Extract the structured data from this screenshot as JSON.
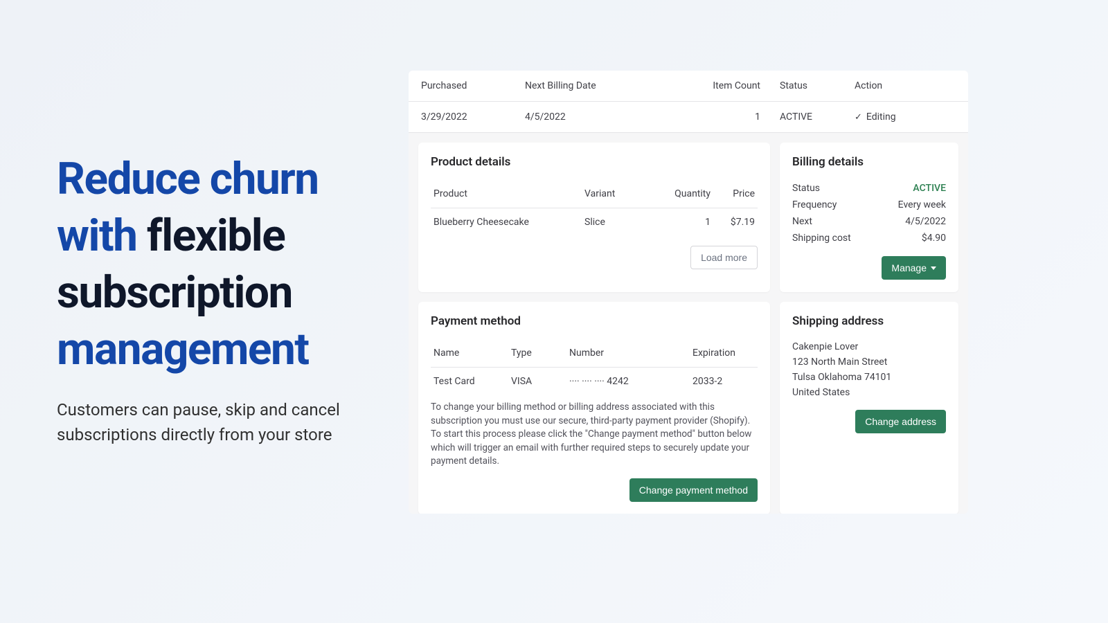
{
  "hero": {
    "line1": "Reduce churn with",
    "line2a": "flexible subscription",
    "line2b": "management",
    "sub": "Customers can pause, skip and cancel subscriptions directly from your store"
  },
  "top": {
    "headers": {
      "purchased": "Purchased",
      "next": "Next Billing Date",
      "count": "Item Count",
      "status": "Status",
      "action": "Action"
    },
    "row": {
      "purchased": "3/29/2022",
      "next": "4/5/2022",
      "count": "1",
      "status": "ACTIVE",
      "action": "Editing"
    }
  },
  "product": {
    "title": "Product details",
    "headers": {
      "product": "Product",
      "variant": "Variant",
      "qty": "Quantity",
      "price": "Price"
    },
    "row": {
      "product": "Blueberry Cheesecake",
      "variant": "Slice",
      "qty": "1",
      "price": "$7.19"
    },
    "load_more": "Load more"
  },
  "billing": {
    "title": "Billing details",
    "rows": [
      {
        "label": "Status",
        "value": "ACTIVE",
        "active": true
      },
      {
        "label": "Frequency",
        "value": "Every week"
      },
      {
        "label": "Next",
        "value": "4/5/2022"
      },
      {
        "label": "Shipping cost",
        "value": "$4.90"
      }
    ],
    "manage": "Manage"
  },
  "payment": {
    "title": "Payment method",
    "headers": {
      "name": "Name",
      "type": "Type",
      "number": "Number",
      "exp": "Expiration"
    },
    "row": {
      "name": "Test Card",
      "type": "VISA",
      "number": "···· ···· ···· 4242",
      "exp": "2033-2"
    },
    "note": "To change your billing method or billing address associated with this subscription you must use our secure, third-party payment provider (Shopify). To start this process please click the \"Change payment method\" button below which will trigger an email with further required steps to securely update your payment details.",
    "button": "Change payment method"
  },
  "shipping": {
    "title": "Shipping address",
    "lines": [
      "Cakenpie Lover",
      "123 North Main Street",
      "Tulsa Oklahoma 74101",
      "United States"
    ],
    "button": "Change address"
  }
}
